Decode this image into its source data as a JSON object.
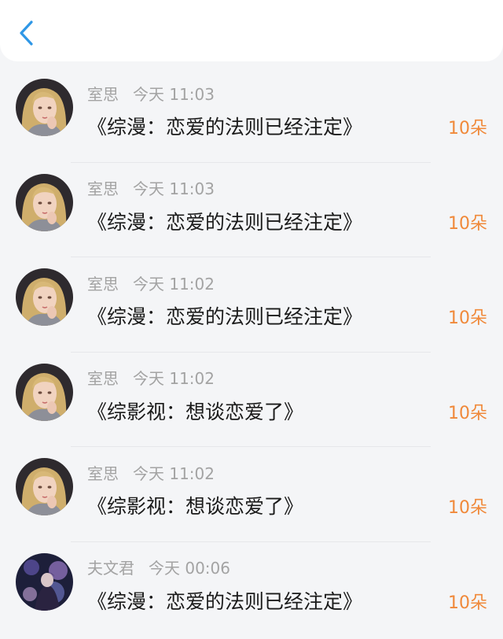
{
  "header": {
    "back_icon": "chevron-left-icon",
    "accent_color": "#2f97e6"
  },
  "rows": [
    {
      "avatar": "avatar-blonde-girl",
      "name": "室思",
      "time": "今天 11:03",
      "title": "《综漫：恋爱的法则已经注定》",
      "amount": "10朵"
    },
    {
      "avatar": "avatar-blonde-girl",
      "name": "室思",
      "time": "今天 11:03",
      "title": "《综漫：恋爱的法则已经注定》",
      "amount": "10朵"
    },
    {
      "avatar": "avatar-blonde-girl",
      "name": "室思",
      "time": "今天 11:02",
      "title": "《综漫：恋爱的法则已经注定》",
      "amount": "10朵"
    },
    {
      "avatar": "avatar-blonde-girl",
      "name": "室思",
      "time": "今天 11:02",
      "title": "《综影视：想谈恋爱了》",
      "amount": "10朵"
    },
    {
      "avatar": "avatar-blonde-girl",
      "name": "室思",
      "time": "今天 11:02",
      "title": "《综影视：想谈恋爱了》",
      "amount": "10朵"
    },
    {
      "avatar": "avatar-dark-figure",
      "name": "夫文君",
      "time": "今天 00:06",
      "title": "《综漫：恋爱的法则已经注定》",
      "amount": "10朵"
    }
  ]
}
